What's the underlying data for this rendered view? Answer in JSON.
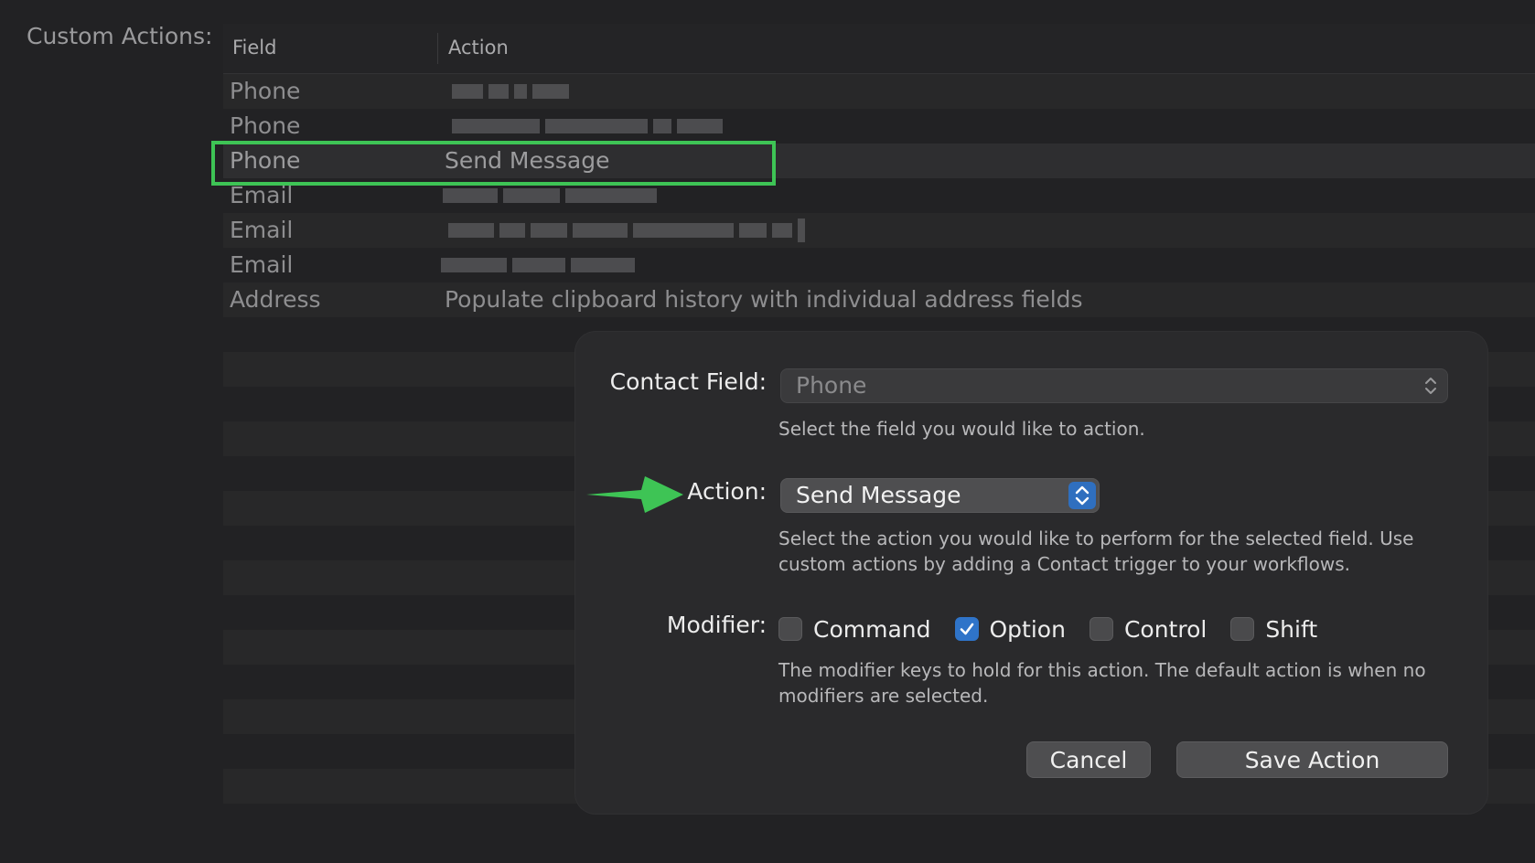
{
  "section": {
    "label": "Custom Actions:"
  },
  "table": {
    "headers": {
      "field": "Field",
      "action": "Action"
    },
    "rows": [
      {
        "field": "Phone",
        "action": ""
      },
      {
        "field": "Phone",
        "action": ""
      },
      {
        "field": "Phone",
        "action": "Send Message"
      },
      {
        "field": "Email",
        "action": ""
      },
      {
        "field": "Email",
        "action": ""
      },
      {
        "field": "Email",
        "action": ""
      },
      {
        "field": "Address",
        "action": "Populate clipboard history with individual address fields"
      }
    ]
  },
  "sheet": {
    "contact_field": {
      "label": "Contact Field:",
      "value": "Phone",
      "help": "Select the field you would like to action."
    },
    "action": {
      "label": "Action:",
      "value": "Send Message",
      "help": "Select the action you would like to perform for the selected field. Use custom actions by adding a Contact trigger to your workflows."
    },
    "modifier": {
      "label": "Modifier:",
      "options": [
        {
          "label": "Command",
          "checked": false
        },
        {
          "label": "Option",
          "checked": true
        },
        {
          "label": "Control",
          "checked": false
        },
        {
          "label": "Shift",
          "checked": false
        }
      ],
      "help": "The modifier keys to hold for this action. The default action is when no modifiers are selected."
    },
    "buttons": {
      "cancel": "Cancel",
      "save": "Save Action"
    }
  },
  "colors": {
    "highlight": "#3ec455",
    "accent": "#2f74c9",
    "background": "#222224",
    "sheet": "#2a2a2c"
  },
  "icons": {
    "annotation_arrow": "green-arrow-icon",
    "checkmark": "checkmark-icon",
    "select_chevrons": "up-down-chevron-icon"
  }
}
